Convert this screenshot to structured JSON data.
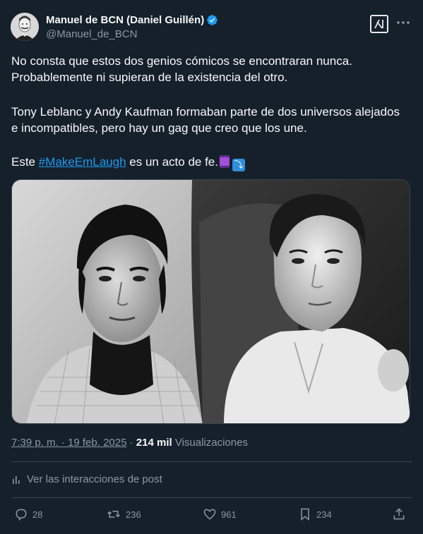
{
  "author": {
    "name": "Manuel de BCN (Daniel Guillén)",
    "handle": "@Manuel_de_BCN",
    "verified": true
  },
  "post": {
    "line1": "No consta que estos dos genios cómicos se encontraran nunca.",
    "line2": "Probablemente ni supieran de la existencia del otro.",
    "line3": "Tony Leblanc y Andy Kaufman formaban parte de dos universos alejados",
    "line4": "e incompatibles, pero hay un gag que creo que los une.",
    "line5_prefix": "Este ",
    "hashtag": "#MakeEmLaugh",
    "line5_suffix": " es un acto de fe.",
    "emojis": [
      "thread-spool",
      "right-arrow-curving-down"
    ]
  },
  "meta": {
    "timestamp": "7:39 p. m. · 19 feb. 2025",
    "separator": " · ",
    "views": "214 mil",
    "views_label": "Visualizaciones"
  },
  "interactions_label": "Ver las interacciones de post",
  "actions": {
    "replies": "28",
    "reposts": "236",
    "likes": "961",
    "bookmarks": "234"
  },
  "colors": {
    "background": "#15202b",
    "text": "#f7f9f9",
    "secondary": "#8b98a5",
    "accent": "#1d9bf0",
    "border": "#38444d"
  }
}
